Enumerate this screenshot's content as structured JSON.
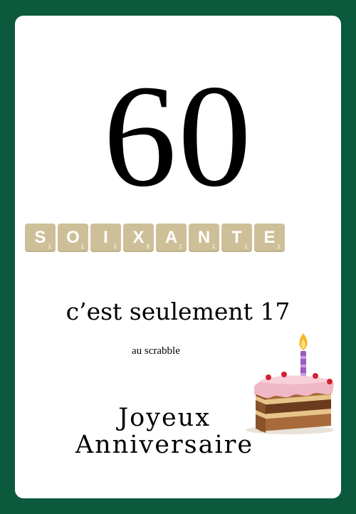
{
  "card": {
    "number": "60",
    "word_tiles": [
      {
        "letter": "S",
        "points": "1"
      },
      {
        "letter": "O",
        "points": "1"
      },
      {
        "letter": "I",
        "points": "1"
      },
      {
        "letter": "X",
        "points": "8"
      },
      {
        "letter": "A",
        "points": "1"
      },
      {
        "letter": "N",
        "points": "1"
      },
      {
        "letter": "T",
        "points": "1"
      },
      {
        "letter": "E",
        "points": "1"
      }
    ],
    "subtitle": "c’est seulement 17",
    "small_text": "au scrabble",
    "greeting_line1": "Joyeux",
    "greeting_line2": "Anniversaire"
  },
  "colors": {
    "background": "#0b5a3e",
    "card": "#ffffff",
    "tile": "#cdbf98",
    "cake_icing": "#f0b8c6",
    "candle": "#9a5cc0"
  },
  "icons": {
    "cake": "birthday-cake-icon"
  }
}
